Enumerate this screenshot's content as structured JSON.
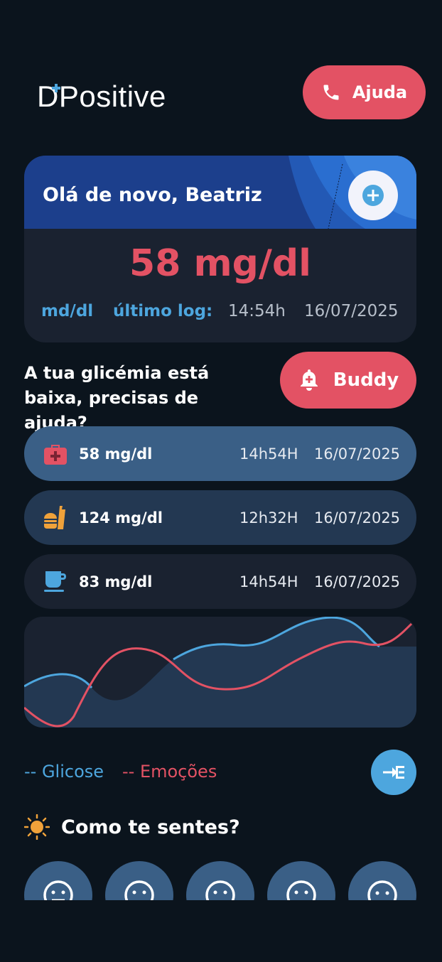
{
  "header": {
    "logo_text": "Positive",
    "logo_letter": "D",
    "help_label": "Ajuda"
  },
  "card": {
    "greeting": "Olá de novo, Beatriz",
    "reading": "58 mg/dl",
    "unit": "md/dl",
    "last_log_label": "último log:",
    "last_log_time": "14:54h",
    "last_log_date": "16/07/2025"
  },
  "alert": {
    "message": "A tua glicémia está baixa, precisas de ajuda?",
    "buddy_label": "Buddy"
  },
  "logs": [
    {
      "icon": "medical-kit-icon",
      "value": "58 mg/dl",
      "time": "14h54H",
      "date": "16/07/2025"
    },
    {
      "icon": "food-icon",
      "value": "124 mg/dl",
      "time": "12h32H",
      "date": "16/07/2025"
    },
    {
      "icon": "coffee-icon",
      "value": "83 mg/dl",
      "time": "14h54H",
      "date": "16/07/2025"
    }
  ],
  "legend": {
    "glucose": "-- Glicose",
    "emotions": "-- Emoções"
  },
  "mood": {
    "title": "Como te sentes?",
    "options": [
      "neutral-face",
      "neutral-face",
      "neutral-face",
      "neutral-face",
      "sad-face"
    ]
  },
  "colors": {
    "background": "#0b141d",
    "accent_red": "#e35264",
    "accent_blue": "#4da6de",
    "card_dark": "#1a2230",
    "card_header": "#1c3f8c",
    "row_active": "#3a5f86",
    "row_mid": "#233852",
    "row_dark": "#1a2230",
    "mood_bg": "#3a5f86"
  }
}
